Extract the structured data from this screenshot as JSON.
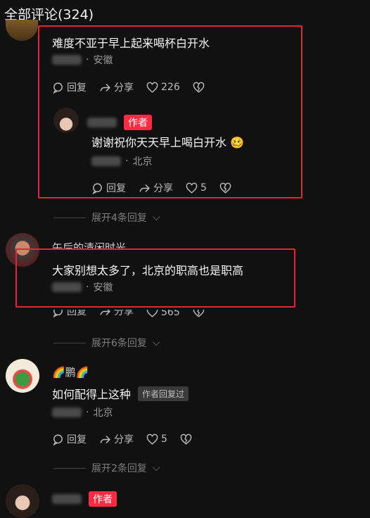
{
  "header": {
    "title": "全部评论(324)"
  },
  "comment1": {
    "text": "难度不亚于早上起来喝杯白开水",
    "location": "安徽",
    "reply_label": "回复",
    "share_label": "分享",
    "likes": "226"
  },
  "reply1": {
    "author_badge": "作者",
    "text": "谢谢祝你天天早上喝白开水",
    "emoji": "🥴",
    "location": "北京",
    "reply_label": "回复",
    "share_label": "分享",
    "likes": "5"
  },
  "expand1": {
    "label": "展开4条回复"
  },
  "comment2": {
    "username": "午后的清闲时光",
    "text": "大家别想太多了，北京的职高也是职高",
    "location": "安徽",
    "reply_label": "回复",
    "share_label": "分享",
    "likes": "565"
  },
  "expand2": {
    "label": "展开6条回复"
  },
  "comment3": {
    "username": "🌈鹏🌈",
    "text": "如何配得上这种",
    "author_replied_badge": "作者回复过",
    "location": "北京",
    "reply_label": "回复",
    "share_label": "分享",
    "likes": "5"
  },
  "expand3": {
    "label": "展开2条回复"
  },
  "comment4": {
    "author_badge": "作者"
  },
  "colors": {
    "highlight_box": "#e0282e",
    "author_badge": "#ff2b44",
    "background": "#111111"
  }
}
